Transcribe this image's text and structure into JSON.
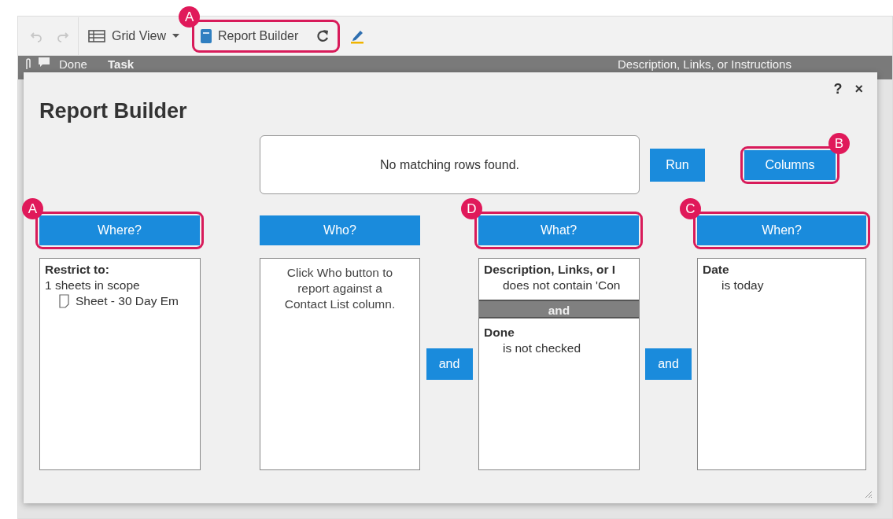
{
  "toolbar": {
    "undo": {
      "disabled": true
    },
    "redo": {
      "disabled": true
    },
    "view_menu": {
      "label": "Grid View"
    },
    "report_builder": {
      "label": "Report Builder",
      "callout": {
        "letter": "A"
      }
    }
  },
  "grid_header": {
    "columns": [
      "Done",
      "Task",
      "Description, Links, or Instructions"
    ]
  },
  "dialog": {
    "title": "Report Builder",
    "help": "?",
    "close": "×",
    "result_message": "No matching rows found.",
    "actions": [
      {
        "label": "Run"
      },
      {
        "label": "Columns",
        "callout": {
          "letter": "B"
        }
      }
    ],
    "panels": [
      {
        "button": "Where?",
        "kind": "scope",
        "callout": {
          "letter": "A"
        },
        "heading": "Restrict to:",
        "summary": "1 sheets in scope",
        "sheets": [
          "Sheet - 30 Day Em"
        ]
      },
      {
        "button": "Who?",
        "kind": "hint",
        "text": "Click Who button to report against a Contact List column."
      },
      {
        "button": "What?",
        "kind": "criteria",
        "join_before": "and",
        "callout": {
          "letter": "D"
        },
        "criteria": [
          {
            "field": "Description, Links, or I",
            "condition": "does not contain 'Con"
          },
          {
            "joiner": "and",
            "field": "Done",
            "condition": "is not checked"
          }
        ]
      },
      {
        "button": "When?",
        "kind": "criteria",
        "join_before": "and",
        "callout": {
          "letter": "C"
        },
        "criteria": [
          {
            "field": "Date",
            "condition": "is today"
          }
        ]
      }
    ]
  }
}
